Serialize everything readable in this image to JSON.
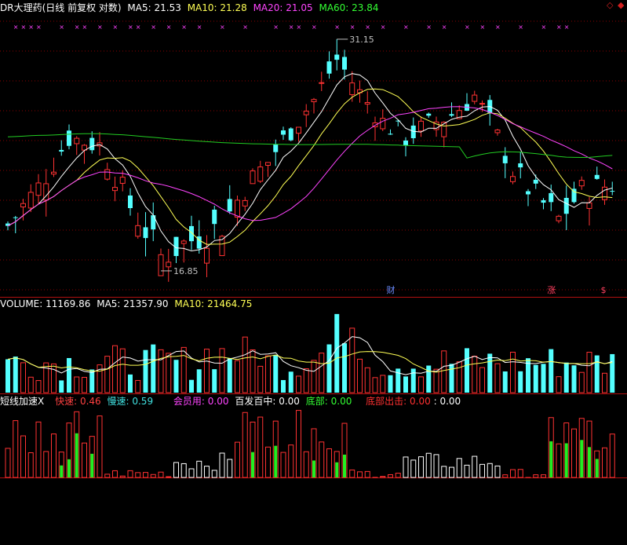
{
  "header": {
    "stock": "DR大理药",
    "mode": "(日线 前复权 对数)",
    "ma": [
      {
        "label": "MA5:",
        "value": "21.53",
        "color": "#ffffff"
      },
      {
        "label": "MA10:",
        "value": "21.28",
        "color": "#ffff55"
      },
      {
        "label": "MA20:",
        "value": "21.05",
        "color": "#ff44ff"
      },
      {
        "label": "MA60:",
        "value": "23.84",
        "color": "#33ff33"
      }
    ]
  },
  "volume_header": {
    "label": "VOLUME:",
    "value": "11169.86",
    "ma5": {
      "label": "MA5:",
      "value": "21357.90",
      "color": "#ffffff"
    },
    "ma10": {
      "label": "MA10:",
      "value": "21464.75",
      "color": "#ffff55"
    }
  },
  "indicator_header": {
    "name": "短线加速X",
    "items": [
      {
        "label": "快速:",
        "value": "0.46",
        "color": "#ff4040"
      },
      {
        "label": "慢速:",
        "value": "0.59",
        "color": "#40e0e0"
      },
      {
        "label": "会员用:",
        "value": "0.00",
        "color": "#ff44ff"
      },
      {
        "label": "百发百中:",
        "value": "0.00",
        "color": "#ffffff"
      },
      {
        "label": "底部:",
        "value": "0.00",
        "color": "#33ff33"
      },
      {
        "label": "底部出击:",
        "value": "0.00",
        "color": "#ff3030"
      },
      {
        "label": ":",
        "value": "0.00",
        "color": "#ffffff"
      }
    ]
  },
  "chart_data": {
    "type": "candlestick",
    "annotations": {
      "high": {
        "text": "31.15",
        "index": 43
      },
      "low": {
        "text": "16.85",
        "index": 20
      }
    },
    "markers": [
      {
        "text": "财",
        "index": 50
      },
      {
        "text": "涨",
        "index": 71
      },
      {
        "text": "$",
        "index": 78
      }
    ],
    "x_marks": [
      1,
      2,
      3,
      4,
      7,
      9,
      10,
      12,
      14,
      16,
      17,
      19,
      21,
      23,
      25,
      28,
      31,
      35,
      37,
      38,
      40,
      43,
      45,
      47,
      49,
      52,
      55,
      57,
      60,
      62,
      64,
      67,
      70,
      72,
      73
    ]
  },
  "colors": {
    "up": "#ff3232",
    "down": "#54ffff",
    "ma5": "#ffffff",
    "ma10": "#ffff55",
    "ma20": "#ff44ff",
    "ma60": "#22cc22",
    "grid": "#8b0000",
    "text": "#c0c0c0"
  }
}
